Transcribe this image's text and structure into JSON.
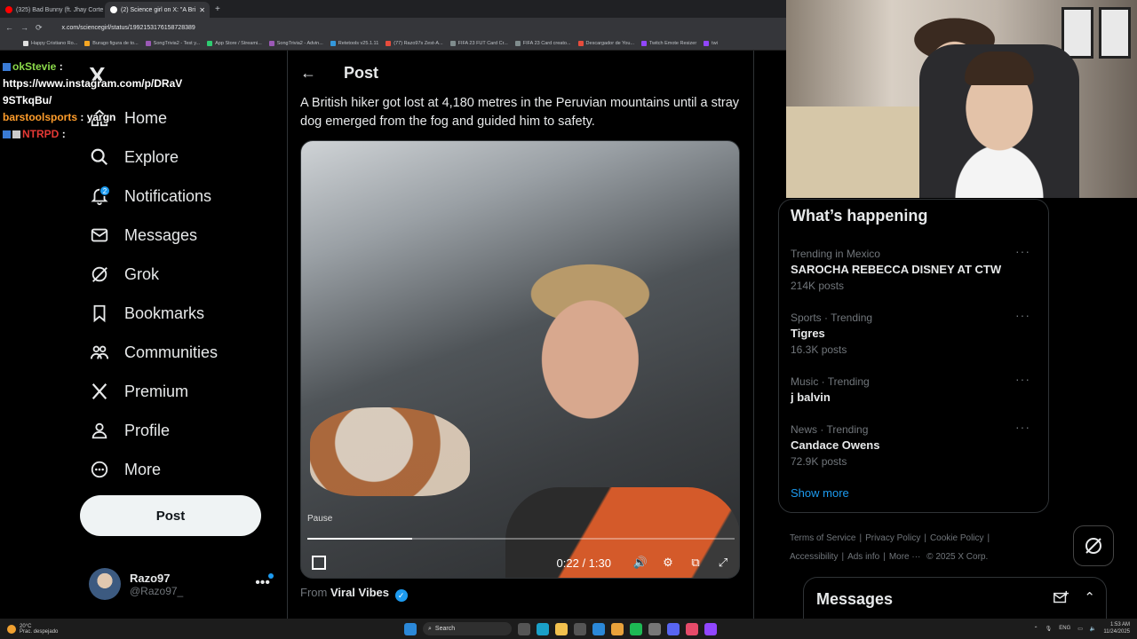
{
  "browser": {
    "tabs": [
      {
        "title": "(325) Bad Bunny (ft. Jhay Corte",
        "favicon_color": "#ff0000"
      },
      {
        "title": "(2) Science girl on X: \"A Bri",
        "favicon_color": "#ffffff"
      }
    ],
    "new_tab": "+",
    "url": "x.com/sciencegirl/status/1992153176158728389",
    "bookmarks": [
      {
        "label": "Happy Cristiano Ro...",
        "color": "#e0e0e0"
      },
      {
        "label": "Burago figura de to...",
        "color": "#f5a623"
      },
      {
        "label": "SongTrivia2 - Test y...",
        "color": "#9b59b6"
      },
      {
        "label": "App Store / Streami...",
        "color": "#2ecc71"
      },
      {
        "label": "SongTrivia2 - Advin...",
        "color": "#9b59b6"
      },
      {
        "label": "Retetools v25.1.11",
        "color": "#3498db"
      },
      {
        "label": "(77) Razo97s Zest-A...",
        "color": "#e74c3c"
      },
      {
        "label": "FIFA 23 FUT Card Cr...",
        "color": "#7f8c8d"
      },
      {
        "label": "FIFA 23 Card creato...",
        "color": "#7f8c8d"
      },
      {
        "label": "Descargador de You...",
        "color": "#e74c3c"
      },
      {
        "label": "Twitch Emote Resizer",
        "color": "#9146ff"
      },
      {
        "label": "twi",
        "color": "#9146ff"
      }
    ]
  },
  "chat": {
    "line1_user": "okStevie",
    "line1_sep": ":",
    "line2": "https://www.instagram.com/p/DRaV",
    "line3": "9STkqBu/",
    "line4_user": "barstoolsports",
    "line4_msg": ": yargn",
    "line5_user": "NTRPD",
    "line5_sep": ":"
  },
  "nav": {
    "logo": "X",
    "items": [
      {
        "label": "Home",
        "icon": "home-icon"
      },
      {
        "label": "Explore",
        "icon": "search-icon"
      },
      {
        "label": "Notifications",
        "icon": "bell-icon",
        "badge": "2"
      },
      {
        "label": "Messages",
        "icon": "envelope-icon"
      },
      {
        "label": "Grok",
        "icon": "grok-icon"
      },
      {
        "label": "Bookmarks",
        "icon": "bookmark-icon"
      },
      {
        "label": "Communities",
        "icon": "people-icon"
      },
      {
        "label": "Premium",
        "icon": "x-logo-icon"
      },
      {
        "label": "Profile",
        "icon": "person-icon"
      },
      {
        "label": "More",
        "icon": "more-circle-icon"
      }
    ],
    "post_button": "Post",
    "account": {
      "name": "Razo97",
      "handle": "@Razo97_",
      "more": "•••"
    }
  },
  "post": {
    "heading": "Post",
    "text": "A British hiker got lost at 4,180 metres in the Peruvian mountains until a stray dog emerged from the fog and guided him to safety.",
    "video": {
      "pause_label": "Pause",
      "time": "0:22 / 1:30",
      "progress": 0.245
    },
    "source_prefix": "From",
    "source_name": "Viral Vibes",
    "verified": "✓"
  },
  "trends": {
    "title": "What’s happening",
    "items": [
      {
        "meta": "Trending in Mexico",
        "name": "SAROCHA REBECCA DISNEY AT CTW",
        "count": "214K posts"
      },
      {
        "meta": "Sports · Trending",
        "name": "Tigres",
        "count": "16.3K posts"
      },
      {
        "meta": "Music · Trending",
        "name": "j balvin",
        "count": ""
      },
      {
        "meta": "News · Trending",
        "name": "Candace Owens",
        "count": "72.9K posts"
      }
    ],
    "more": "···",
    "show_more": "Show more"
  },
  "footer": {
    "links": [
      "Terms of Service",
      "Privacy Policy",
      "Cookie Policy",
      "Accessibility",
      "Ads info",
      "More ···"
    ],
    "copyright": "© 2025 X Corp."
  },
  "messages": {
    "title": "Messages"
  },
  "taskbar": {
    "temp": "20°C",
    "weather": "Prac. despejado",
    "search": "Search",
    "lang": "ENG",
    "time": "1:53 AM",
    "date": "11/24/2025"
  },
  "colors": {
    "accent": "#1d9bf0",
    "bg": "#000000",
    "border": "#2f3336",
    "muted": "#71767b"
  }
}
